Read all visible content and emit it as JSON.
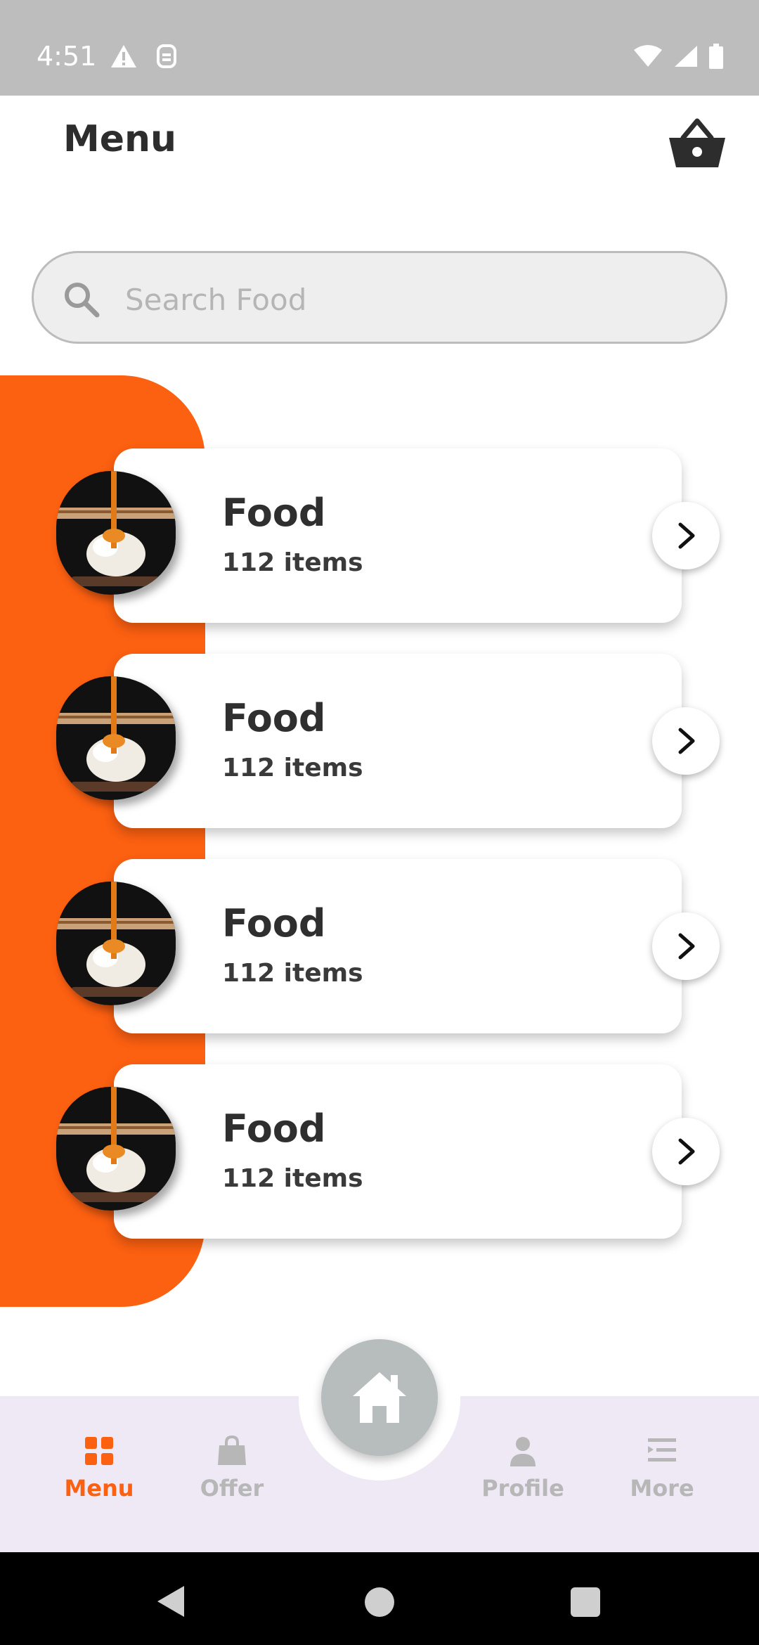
{
  "status_bar": {
    "time": "4:51"
  },
  "header": {
    "title": "Menu"
  },
  "search": {
    "placeholder": "Search Food"
  },
  "categories": [
    {
      "name": "Food",
      "count": "112 items"
    },
    {
      "name": "Food",
      "count": "112 items"
    },
    {
      "name": "Food",
      "count": "112 items"
    },
    {
      "name": "Food",
      "count": "112 items"
    }
  ],
  "bottom_nav": {
    "items": [
      {
        "label": "Menu",
        "icon": "grid-icon",
        "active": true
      },
      {
        "label": "Offer",
        "icon": "shopping-bag-icon",
        "active": false
      },
      {
        "label": "Profile",
        "icon": "person-icon",
        "active": false
      },
      {
        "label": "More",
        "icon": "list-icon",
        "active": false
      }
    ],
    "center_icon": "home-icon"
  },
  "colors": {
    "accent": "#fc6011",
    "status_bar": "#bdbdbd",
    "nav_background": "#efe9f5",
    "inactive": "#b7b7b7",
    "home_button": "#b7bcbd"
  }
}
